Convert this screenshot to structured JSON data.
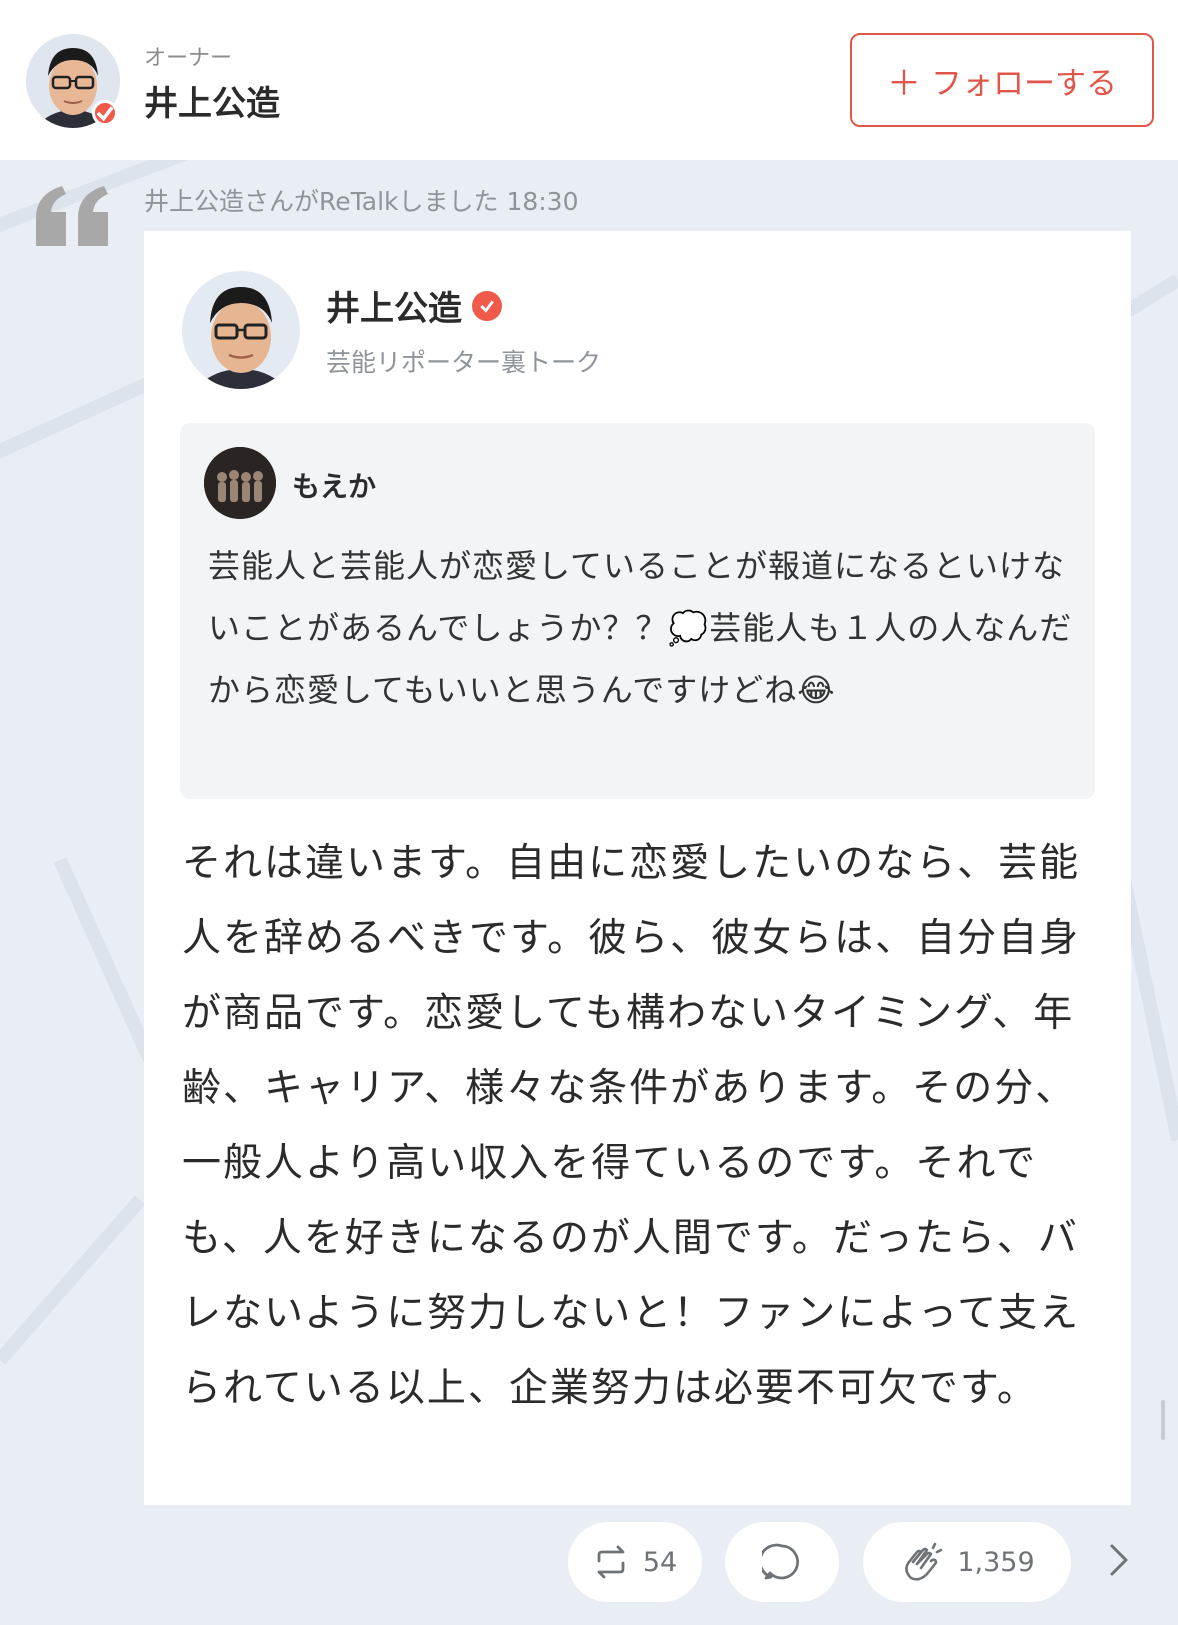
{
  "header": {
    "owner_role": "オーナー",
    "owner_name": "井上公造",
    "follow_plus": "＋",
    "follow_label": "フォローする"
  },
  "retalk": {
    "line": "井上公造さんがReTalkしました 18:30"
  },
  "post": {
    "author_name": "井上公造",
    "channel": "芸能リポーター裏トーク",
    "question": {
      "asker": "もえか",
      "text": "芸能人と芸能人が恋愛していることが報道になるといけないことがあるんでしょうか？？💭芸能人も１人の人なんだから恋愛してもいいと思うんですけどね😂"
    },
    "answer": "それは違います。自由に恋愛したいのなら、芸能人を辞めるべきです。彼ら、彼女らは、自分自身が商品です。恋愛しても構わないタイミング、年齢、キャリア、様々な条件があります。その分、一般人より高い収入を得ているのです。それでも、人を好きになるのが人間です。だったら、バレないように努力しないと！ファンによって支えられている以上、企業努力は必要不可欠です。"
  },
  "actions": {
    "retalk_count": "54",
    "clap_count": "1,359"
  },
  "colors": {
    "accent": "#e0564a",
    "background": "#e9eef5",
    "card": "#ffffff",
    "muted": "#8f949b"
  }
}
